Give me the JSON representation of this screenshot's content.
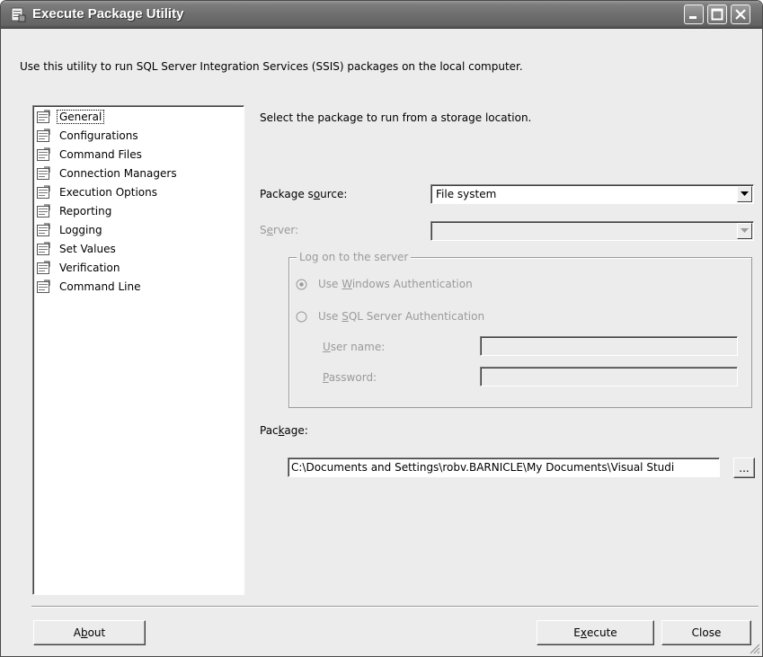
{
  "window": {
    "title": "Execute Package Utility",
    "icon": "package-app-icon"
  },
  "description": "Use this utility to run SQL Server Integration Services (SSIS) packages on the local computer.",
  "nav": {
    "selected": "General",
    "items": [
      {
        "label": "General",
        "icon": "page-icon"
      },
      {
        "label": "Configurations",
        "icon": "page-icon"
      },
      {
        "label": "Command Files",
        "icon": "page-icon"
      },
      {
        "label": "Connection Managers",
        "icon": "page-icon"
      },
      {
        "label": "Execution Options",
        "icon": "page-icon"
      },
      {
        "label": "Reporting",
        "icon": "page-icon"
      },
      {
        "label": "Logging",
        "icon": "page-icon"
      },
      {
        "label": "Set Values",
        "icon": "page-icon"
      },
      {
        "label": "Verification",
        "icon": "page-icon"
      },
      {
        "label": "Command Line",
        "icon": "page-icon"
      }
    ]
  },
  "panel": {
    "instruction": "Select the package to run from a storage location.",
    "package_source": {
      "label_pre": "Package s",
      "label_key": "o",
      "label_post": "urce:",
      "value": "File system"
    },
    "server": {
      "label_pre": "S",
      "label_key": "e",
      "label_post": "rver:",
      "value": ""
    },
    "logon": {
      "title": "Log on to the server",
      "windows_auth": {
        "pre": "Use ",
        "key": "W",
        "post": "indows Authentication",
        "checked": true
      },
      "sql_auth": {
        "pre": "Use ",
        "key": "S",
        "post": "QL Server Authentication",
        "checked": false
      },
      "user_name": {
        "key": "U",
        "post": "ser name:",
        "value": ""
      },
      "password": {
        "key": "P",
        "post": "assword:",
        "value": ""
      }
    },
    "package": {
      "label_pre": "Pac",
      "label_key": "k",
      "label_post": "age:",
      "value": "C:\\Documents and Settings\\robv.BARNICLE\\My Documents\\Visual Studi",
      "browse_label": "..."
    }
  },
  "buttons": {
    "about": {
      "pre": "A",
      "key": "b",
      "post": "out"
    },
    "execute": {
      "pre": "E",
      "key": "x",
      "post": "ecute"
    },
    "close": "Close"
  },
  "colors": {
    "titlebar": "#6e6e6e",
    "face": "#ececec",
    "disabled_text": "#9a9a9a"
  }
}
